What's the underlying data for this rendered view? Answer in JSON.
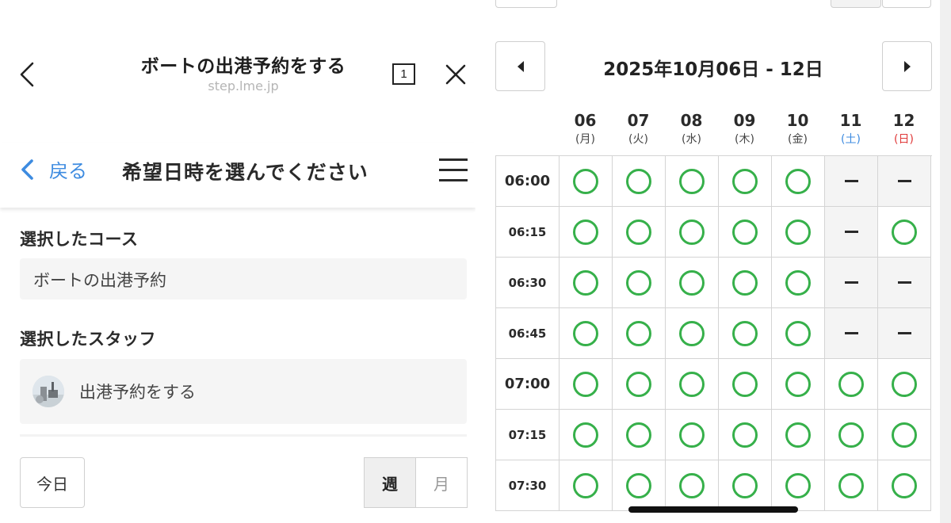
{
  "browser": {
    "title": "ボートの出港予約をする",
    "domain": "step.lme.jp",
    "tab_count": "1"
  },
  "header": {
    "back_label": "戻る",
    "title": "希望日時を選んでください"
  },
  "course": {
    "label": "選択したコース",
    "value": "ボートの出港予約"
  },
  "staff": {
    "label": "選択したスタッフ",
    "value": "出港予約をする"
  },
  "controls": {
    "today_label": "今日",
    "week_label": "週",
    "month_label": "月"
  },
  "calendar": {
    "week_range": "2025年10月06日 - 12日",
    "days": [
      {
        "date": "06",
        "weekday": "(月)",
        "color": "#444444"
      },
      {
        "date": "07",
        "weekday": "(火)",
        "color": "#444444"
      },
      {
        "date": "08",
        "weekday": "(水)",
        "color": "#444444"
      },
      {
        "date": "09",
        "weekday": "(木)",
        "color": "#444444"
      },
      {
        "date": "10",
        "weekday": "(金)",
        "color": "#444444"
      },
      {
        "date": "11",
        "weekday": "(土)",
        "color": "#3d8be0"
      },
      {
        "date": "12",
        "weekday": "(日)",
        "color": "#e03a3a"
      }
    ],
    "rows": [
      {
        "time": "06:00",
        "hour": true,
        "slots": [
          "o",
          "o",
          "o",
          "o",
          "o",
          "-",
          "-"
        ]
      },
      {
        "time": "06:15",
        "hour": false,
        "slots": [
          "o",
          "o",
          "o",
          "o",
          "o",
          "-",
          "o"
        ]
      },
      {
        "time": "06:30",
        "hour": false,
        "slots": [
          "o",
          "o",
          "o",
          "o",
          "o",
          "-",
          "-"
        ]
      },
      {
        "time": "06:45",
        "hour": false,
        "slots": [
          "o",
          "o",
          "o",
          "o",
          "o",
          "-",
          "-"
        ]
      },
      {
        "time": "07:00",
        "hour": true,
        "slots": [
          "o",
          "o",
          "o",
          "o",
          "o",
          "o",
          "o"
        ]
      },
      {
        "time": "07:15",
        "hour": false,
        "slots": [
          "o",
          "o",
          "o",
          "o",
          "o",
          "o",
          "o"
        ]
      },
      {
        "time": "07:30",
        "hour": false,
        "slots": [
          "o",
          "o",
          "o",
          "o",
          "o",
          "o",
          "o"
        ]
      }
    ]
  },
  "colors": {
    "accent": "#3d8be0",
    "available": "#36b04a",
    "saturday": "#3d8be0",
    "sunday": "#e03a3a"
  }
}
